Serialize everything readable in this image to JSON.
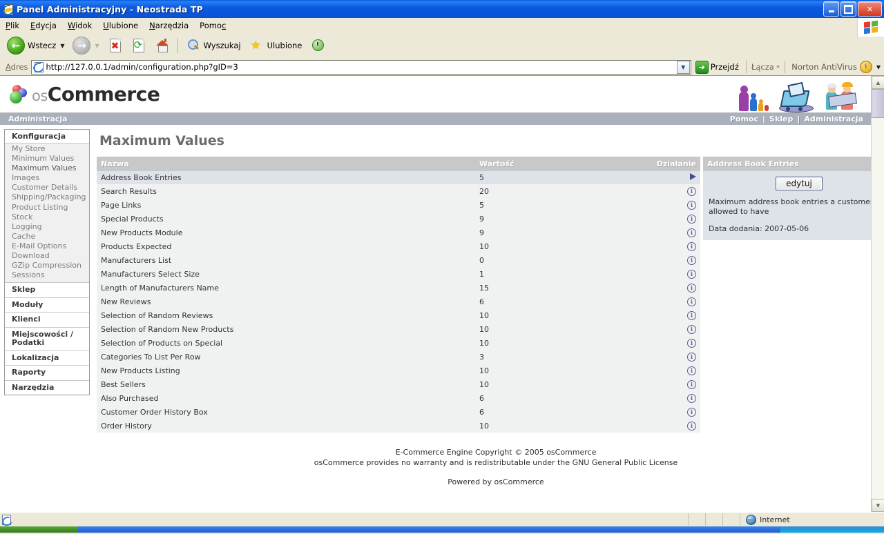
{
  "window": {
    "title": "Panel Administracyjny - Neostrada TP",
    "minimize_label": "Minimalizuj",
    "maximize_label": "Przywróć",
    "close_label": "Zamknij"
  },
  "menubar": {
    "items": [
      {
        "label": "Plik",
        "accel": "P"
      },
      {
        "label": "Edycja",
        "accel": "E"
      },
      {
        "label": "Widok",
        "accel": "W"
      },
      {
        "label": "Ulubione",
        "accel": "U"
      },
      {
        "label": "Narzędzia",
        "accel": "N"
      },
      {
        "label": "Pomoc",
        "accel": "c"
      }
    ]
  },
  "toolbar": {
    "back_label": "Wstecz",
    "forward_label": "",
    "stop_label": "Zatrzymaj",
    "refresh_label": "Odśwież",
    "home_label": "Strona główna",
    "search_label": "Wyszukaj",
    "favorites_label": "Ulubione",
    "history_label": "Historia"
  },
  "addressbar": {
    "label": "Adres",
    "url": "http://127.0.0.1/admin/configuration.php?gID=3",
    "go_label": "Przejdź",
    "links_label": "Łącza",
    "links_chevron": "»",
    "norton_label": "Norton AntiVirus"
  },
  "site": {
    "logo_os": "os",
    "logo_commerce": "Commerce",
    "admin_bar_title": "Administracja",
    "nav": [
      {
        "label": "Pomoc"
      },
      {
        "label": "Sklep"
      },
      {
        "label": "Administracja"
      }
    ],
    "nav_separator": "|"
  },
  "sidebar": {
    "section_title": "Konfiguracja",
    "links": [
      {
        "label": "My Store",
        "active": false
      },
      {
        "label": "Minimum Values",
        "active": false
      },
      {
        "label": "Maximum Values",
        "active": true
      },
      {
        "label": "Images",
        "active": false
      },
      {
        "label": "Customer Details",
        "active": false
      },
      {
        "label": "Shipping/Packaging",
        "active": false
      },
      {
        "label": "Product Listing",
        "active": false
      },
      {
        "label": "Stock",
        "active": false
      },
      {
        "label": "Logging",
        "active": false
      },
      {
        "label": "Cache",
        "active": false
      },
      {
        "label": "E-Mail Options",
        "active": false
      },
      {
        "label": "Download",
        "active": false
      },
      {
        "label": "GZip Compression",
        "active": false
      },
      {
        "label": "Sessions",
        "active": false
      }
    ],
    "sections": [
      {
        "label": "Sklep"
      },
      {
        "label": "Moduły"
      },
      {
        "label": "Klienci"
      },
      {
        "label": "Miejscowości / Podatki"
      },
      {
        "label": "Lokalizacja"
      },
      {
        "label": "Raporty"
      },
      {
        "label": "Narzędzia"
      }
    ]
  },
  "main": {
    "page_title": "Maximum Values",
    "table": {
      "columns": [
        "Nazwa",
        "Wartość",
        "Działanie"
      ],
      "rows": [
        {
          "name": "Address Book Entries",
          "value": "5",
          "selected": true
        },
        {
          "name": "Search Results",
          "value": "20",
          "selected": false
        },
        {
          "name": "Page Links",
          "value": "5",
          "selected": false
        },
        {
          "name": "Special Products",
          "value": "9",
          "selected": false
        },
        {
          "name": "New Products Module",
          "value": "9",
          "selected": false
        },
        {
          "name": "Products Expected",
          "value": "10",
          "selected": false
        },
        {
          "name": "Manufacturers List",
          "value": "0",
          "selected": false
        },
        {
          "name": "Manufacturers Select Size",
          "value": "1",
          "selected": false
        },
        {
          "name": "Length of Manufacturers Name",
          "value": "15",
          "selected": false
        },
        {
          "name": "New Reviews",
          "value": "6",
          "selected": false
        },
        {
          "name": "Selection of Random Reviews",
          "value": "10",
          "selected": false
        },
        {
          "name": "Selection of Random New Products",
          "value": "10",
          "selected": false
        },
        {
          "name": "Selection of Products on Special",
          "value": "10",
          "selected": false
        },
        {
          "name": "Categories To List Per Row",
          "value": "3",
          "selected": false
        },
        {
          "name": "New Products Listing",
          "value": "10",
          "selected": false
        },
        {
          "name": "Best Sellers",
          "value": "10",
          "selected": false
        },
        {
          "name": "Also Purchased",
          "value": "6",
          "selected": false
        },
        {
          "name": "Customer Order History Box",
          "value": "6",
          "selected": false
        },
        {
          "name": "Order History",
          "value": "10",
          "selected": false
        }
      ]
    },
    "info_panel": {
      "title": "Address Book Entries",
      "edit_button": "edytuj",
      "description": "Maximum address book entries a customer is allowed to have",
      "date_label": "Data dodania: 2007-05-06"
    },
    "footer": {
      "line1": "E-Commerce Engine Copyright © 2005 osCommerce",
      "line2": "osCommerce provides no warranty and is redistributable under the GNU General Public License",
      "line3": "Powered by osCommerce"
    }
  },
  "statusbar": {
    "message": "",
    "zone": "Internet"
  }
}
